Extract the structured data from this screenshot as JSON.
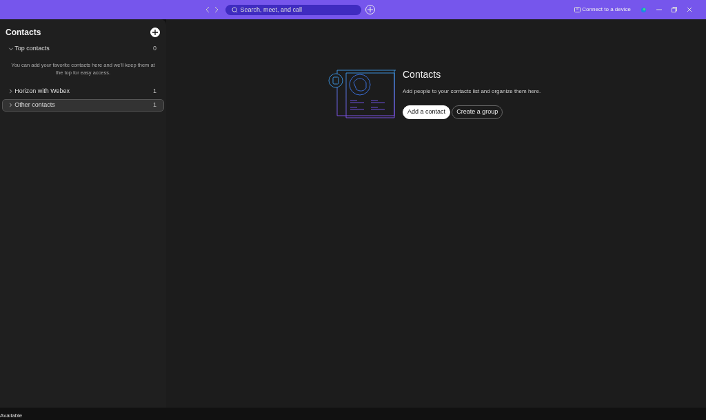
{
  "titlebar": {
    "search": {
      "placeholder": "Search, meet, and call"
    },
    "connect_label": "Connect to a device"
  },
  "sidebar": {
    "title": "Contacts",
    "groups": [
      {
        "label": "Top contacts",
        "count": "0",
        "expanded": true,
        "selected": false,
        "hint": "You can add your favorite contacts here and we'll keep them at the top for easy access."
      },
      {
        "label": "Horizon with Webex",
        "count": "1",
        "expanded": false,
        "selected": false
      },
      {
        "label": "Other contacts",
        "count": "1",
        "expanded": false,
        "selected": true
      }
    ]
  },
  "main": {
    "title": "Contacts",
    "description": "Add people to your contacts list and organize them here.",
    "buttons": [
      {
        "label": "Add a contact",
        "kind": "primary"
      },
      {
        "label": "Create a group",
        "kind": "secondary"
      }
    ]
  },
  "status_bar": {
    "status": "Available"
  }
}
